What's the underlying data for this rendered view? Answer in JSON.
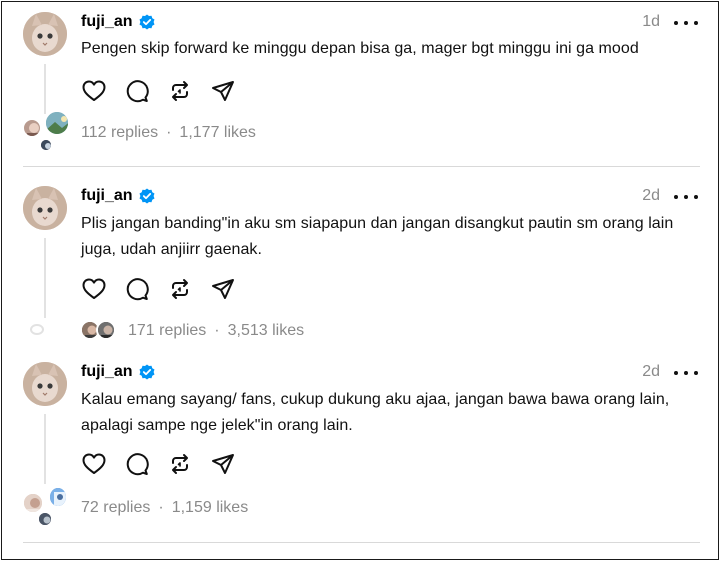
{
  "posts": [
    {
      "username": "fuji_an",
      "time": "1d",
      "text": "Pengen skip forward ke minggu depan bisa ga, mager bgt minggu ini ga mood",
      "replies": "112 replies",
      "separator": "·",
      "likes": "1,177 likes"
    },
    {
      "username": "fuji_an",
      "time": "2d",
      "text": "Plis jangan banding\"in aku sm siapapun dan jangan disangkut pautin sm orang lain juga, udah anjiirr gaenak.",
      "replies": "171 replies",
      "separator": "·",
      "likes": "3,513 likes"
    },
    {
      "username": "fuji_an",
      "time": "2d",
      "text": "Kalau emang sayang/ fans, cukup dukung aku ajaa, jangan bawa bawa orang lain, apalagi sampe nge jelek\"in orang lain.",
      "replies": "72 replies",
      "separator": "·",
      "likes": "1,159 likes"
    }
  ],
  "icons": [
    "verified-badge-icon",
    "more-options-icon",
    "heart-icon",
    "comment-icon",
    "repost-icon",
    "share-icon"
  ],
  "colors": {
    "verified": "#0095f6",
    "muted": "#8a8a8a",
    "divider": "#d9d9d9"
  }
}
